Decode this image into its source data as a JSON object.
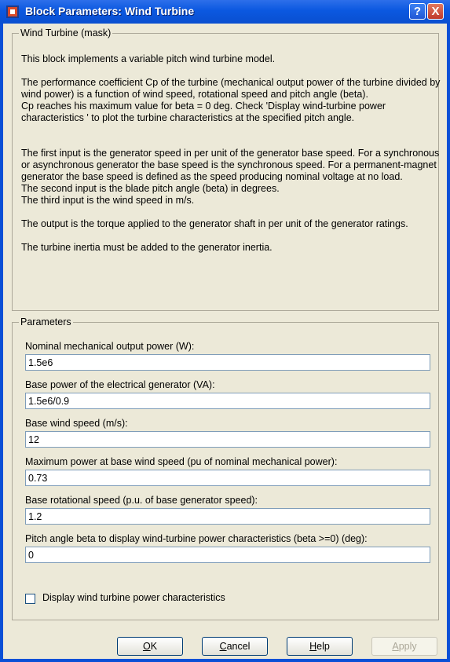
{
  "window": {
    "title": "Block Parameters: Wind Turbine",
    "help_label": "?",
    "close_label": "X"
  },
  "mask": {
    "group_label": "Wind Turbine (mask)",
    "description": "This block implements a variable pitch wind turbine model.\n\nThe performance coefficient Cp of the turbine (mechanical output power of the turbine divided by wind power) is a function of wind speed, rotational speed and pitch angle (beta).\nCp reaches his maximum value for beta = 0 deg. Check 'Display wind-turbine power characteristics ' to plot the turbine characteristics at the specified pitch angle.\n\n\nThe first input is the generator speed in per unit of the generator base speed. For a synchronous or asynchronous generator the base speed is the synchronous speed. For a permanent-magnet generator the base speed is defined as the speed producing nominal voltage at  no load.\nThe second input is the blade pitch angle (beta) in degrees.\nThe third input is the wind speed in m/s.\n\nThe output is the torque applied to the generator shaft in per unit of the generator ratings.\n\nThe turbine inertia must be added to the generator inertia."
  },
  "parameters": {
    "group_label": "Parameters",
    "fields": [
      {
        "label": "Nominal mechanical output power (W):",
        "value": "1.5e6"
      },
      {
        "label": "Base power of the electrical generator (VA):",
        "value": "1.5e6/0.9"
      },
      {
        "label": "Base wind speed (m/s):",
        "value": "12"
      },
      {
        "label": "Maximum power at base wind speed (pu of nominal mechanical power):",
        "value": "0.73"
      },
      {
        "label": "Base rotational speed (p.u. of base generator speed):",
        "value": "1.2"
      },
      {
        "label": "Pitch angle beta to display wind-turbine power characteristics (beta >=0)  (deg):",
        "value": "0"
      }
    ],
    "checkbox_label": "Display wind turbine power characteristics",
    "checkbox_checked": false
  },
  "buttons": {
    "ok": {
      "mnemonic": "O",
      "rest": "K"
    },
    "cancel": {
      "mnemonic": "C",
      "rest": "ancel"
    },
    "help": {
      "mnemonic": "H",
      "rest": "elp"
    },
    "apply": {
      "mnemonic": "A",
      "rest": "pply"
    }
  }
}
